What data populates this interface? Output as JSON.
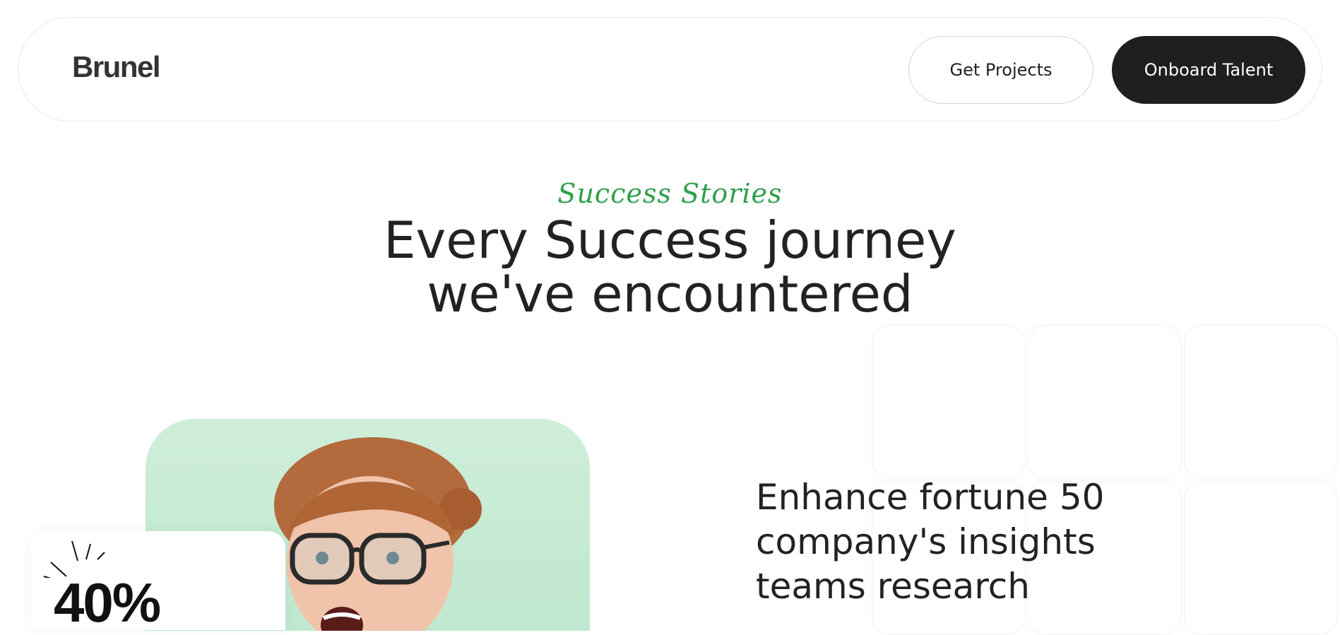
{
  "header": {
    "logo_text": "Brunel",
    "get_projects_label": "Get Projects",
    "onboard_talent_label": "Onboard Talent"
  },
  "hero": {
    "eyebrow": "Success Stories",
    "headline_line1": "Every Success journey",
    "headline_line2": "we've encountered"
  },
  "story": {
    "stat_value": "40%",
    "title_line1": "Enhance fortune 50",
    "title_line2": "company's insights",
    "title_line3": "teams research"
  },
  "colors": {
    "accent_green": "#2fa04b",
    "dark_button": "#1f1f1f",
    "photo_background": "#c6ead3"
  }
}
